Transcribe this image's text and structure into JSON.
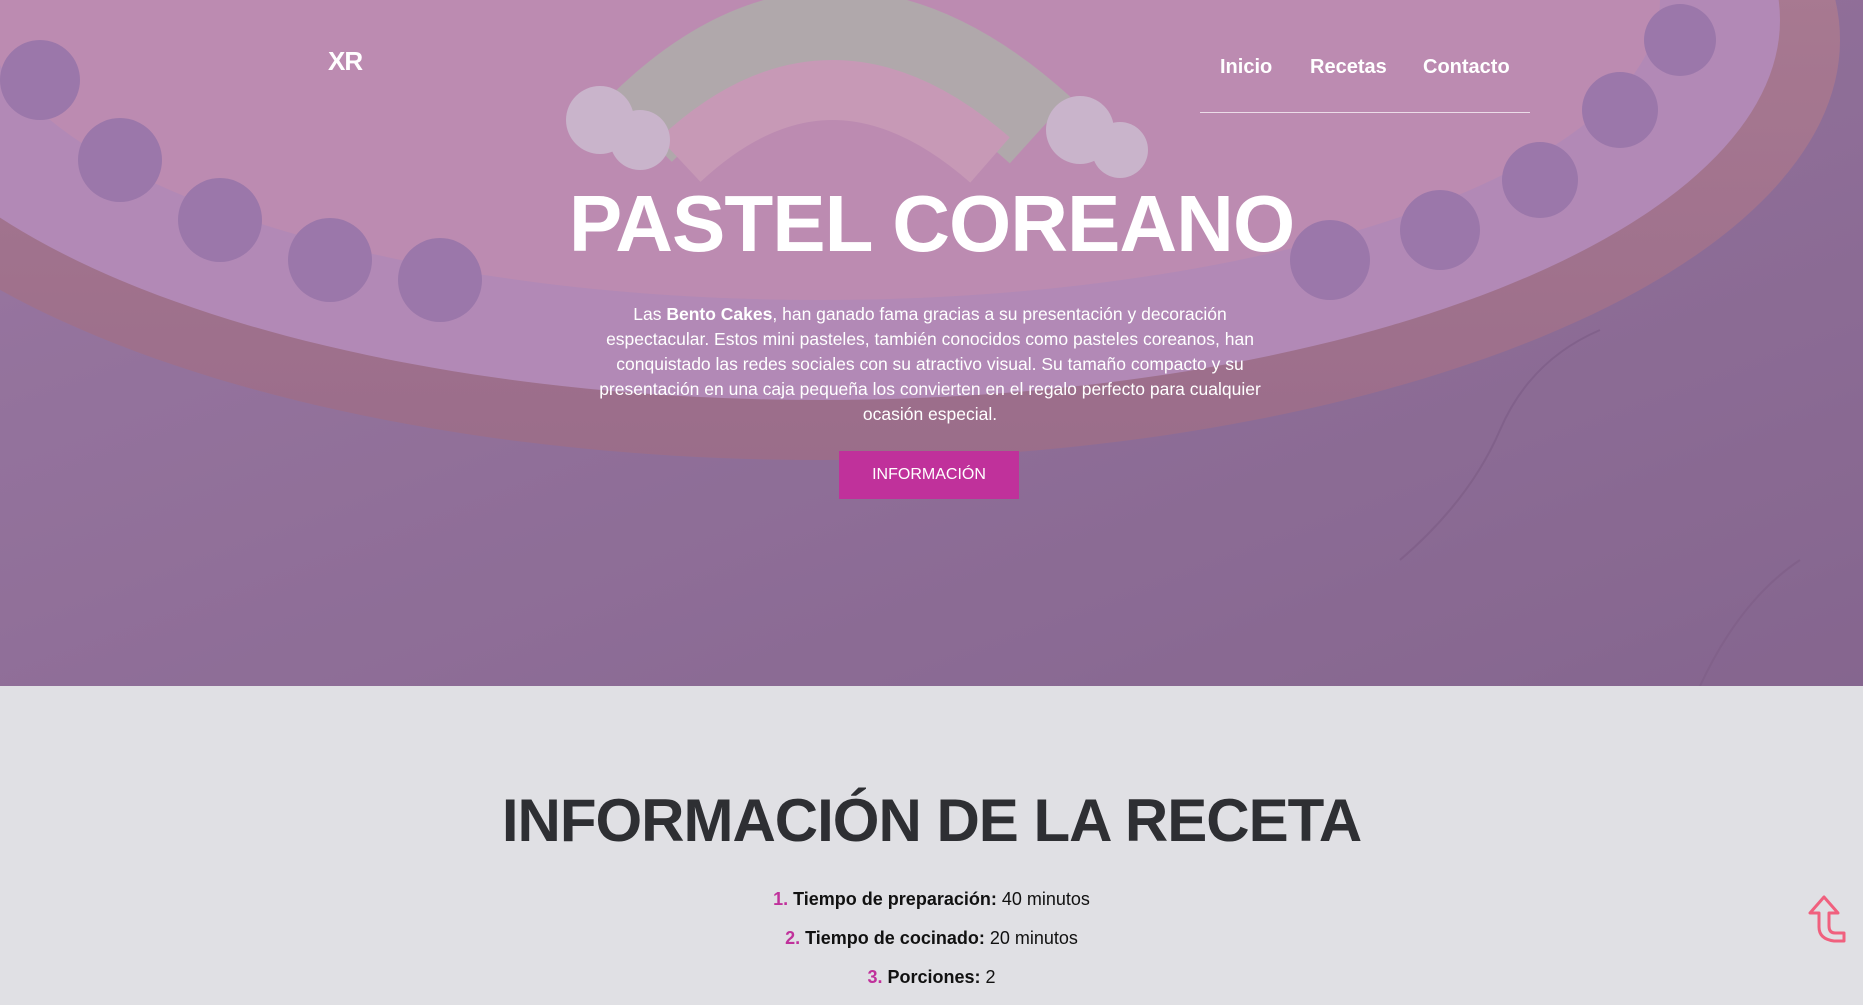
{
  "brand": {
    "logo": "XR"
  },
  "nav": {
    "items": [
      "Inicio",
      "Recetas",
      "Contacto"
    ]
  },
  "hero": {
    "title": "PASTEL COREANO",
    "text_before": "Las ",
    "text_bold": "Bento Cakes",
    "text_after": ", han ganado fama gracias a su presentación y decoración espectacular. Estos mini pasteles, también conocidos como pasteles coreanos, han conquistado las redes sociales con su atractivo visual. Su tamaño compacto y su presentación en una caja pequeña los convierten en el regalo perfecto para cualquier ocasión especial.",
    "button_label": "INFORMACIÓN"
  },
  "info": {
    "title": "INFORMACIÓN DE LA RECETA",
    "items": [
      {
        "num": "1.",
        "label": "Tiempo de preparación:",
        "value": " 40 minutos"
      },
      {
        "num": "2.",
        "label": "Tiempo de cocinado:",
        "value": " 20 minutos"
      },
      {
        "num": "3.",
        "label": "Porciones:",
        "value": " 2"
      }
    ]
  },
  "icons": {
    "scroll_top": "arrow-up-icon"
  },
  "colors": {
    "accent": "#c0319b",
    "section_bg": "#e0e0e4",
    "title_dark": "#2e2f33"
  }
}
